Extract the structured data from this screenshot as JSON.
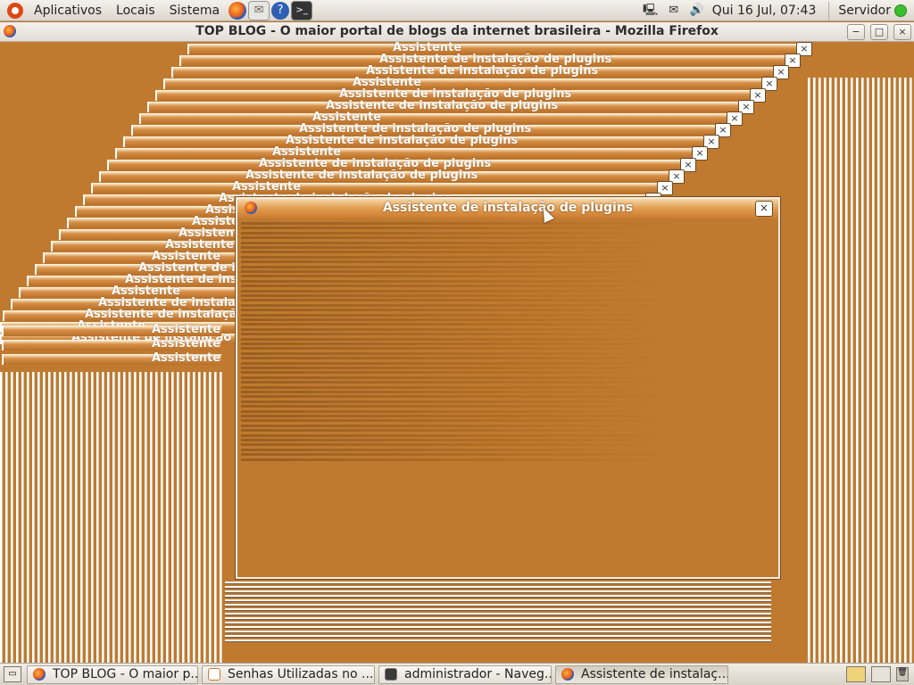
{
  "top_panel": {
    "menus": [
      "Aplicativos",
      "Locais",
      "Sistema"
    ],
    "clock": "Qui 16 Jul, 07:43",
    "user": "Servidor",
    "status_color": "#3cbf2c",
    "launchers": [
      "firefox-icon",
      "mail-icon",
      "help-icon",
      "terminal-icon"
    ]
  },
  "firefox_window": {
    "title": "TOP BLOG - O maior portal de blogs da internet brasileira - Mozilla Firefox",
    "minimize": "−",
    "maximize": "□",
    "close": "×"
  },
  "dialog": {
    "title": "Assistente de instalação de plugins",
    "close": "×"
  },
  "ghost_labels": {
    "full": "Assistente de instalação de plugins",
    "partial": "Assistente"
  },
  "taskbar": {
    "items": [
      {
        "label": "TOP BLOG - O maior p...",
        "icon": "firefox-icon"
      },
      {
        "label": "Senhas Utilizadas no ...",
        "icon": "document-icon"
      },
      {
        "label": "administrador - Naveg...",
        "icon": "terminal-icon"
      },
      {
        "label": "Assistente de instalaç...",
        "icon": "firefox-icon"
      }
    ]
  },
  "colors": {
    "desktop": "#c07a2f",
    "titlebar": "#e19b4d"
  }
}
